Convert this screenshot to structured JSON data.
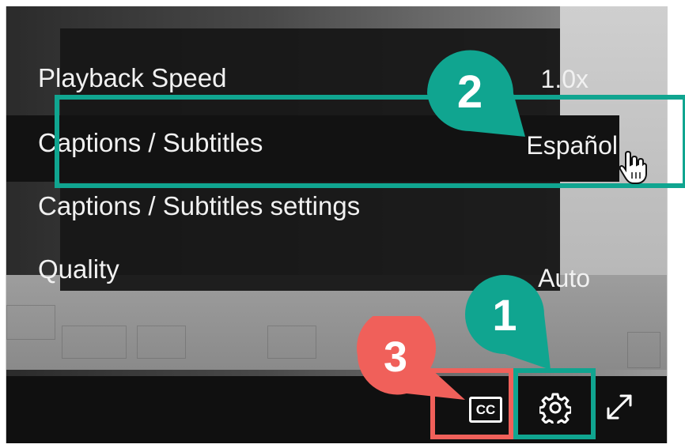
{
  "menu": {
    "items": [
      {
        "label": "Playback Speed",
        "value": "1.0x"
      },
      {
        "label": "Captions / Subtitles",
        "value": "Español"
      },
      {
        "label": "Captions / Subtitles settings",
        "value": ""
      },
      {
        "label": "Quality",
        "value": "Auto"
      }
    ]
  },
  "controls": {
    "cc_label": "CC"
  },
  "callouts": {
    "one": "1",
    "two": "2",
    "three": "3"
  },
  "colors": {
    "green": "#10a590",
    "red": "#f0605a"
  }
}
